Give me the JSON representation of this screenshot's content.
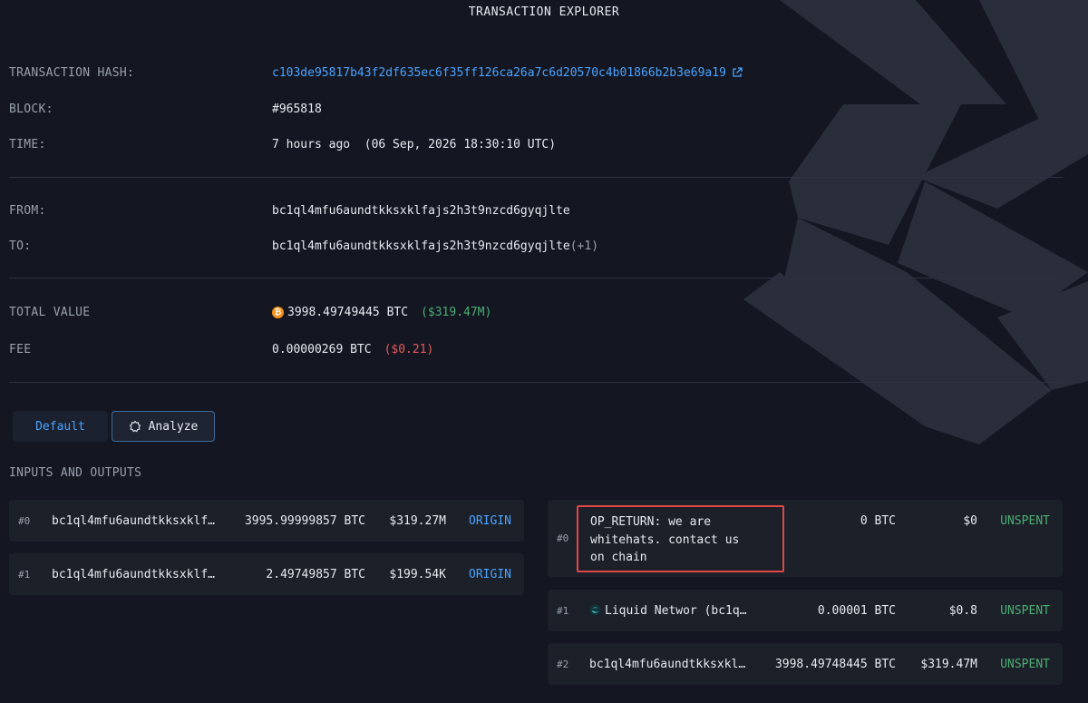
{
  "page_title": "TRANSACTION EXPLORER",
  "details": {
    "hash_label": "TRANSACTION HASH:",
    "hash_value": "c103de95817b43f2df635ec6f35ff126ca26a7c6d20570c4b01866b2b3e69a19",
    "block_label": "BLOCK:",
    "block_value": "#965818",
    "time_label": "TIME:",
    "time_value": "7 hours ago  (06 Sep, 2026 18:30:10 UTC)",
    "from_label": "FROM:",
    "from_value": "bc1ql4mfu6aundtkksxklfajs2h3t9nzcd6gyqjlte",
    "to_label": "TO:",
    "to_value": "bc1ql4mfu6aundtkksxklfajs2h3t9nzcd6gyqjlte",
    "to_extra": "(+1)",
    "total_label": "TOTAL VALUE",
    "total_value": "3998.49749445 BTC",
    "total_usd": "($319.47M)",
    "fee_label": "FEE",
    "fee_value": "0.00000269 BTC",
    "fee_usd": "($0.21)"
  },
  "tabs": {
    "default_label": "Default",
    "analyze_label": "Analyze"
  },
  "io_title": "INPUTS AND OUTPUTS",
  "inputs": [
    {
      "index": "#0",
      "address": "bc1ql4mfu6aundtkksxklf…",
      "amount": "3995.99999857 BTC",
      "usd": "$319.27M",
      "tag": "ORIGIN"
    },
    {
      "index": "#1",
      "address": "bc1ql4mfu6aundtkksxklf…",
      "amount": "2.49749857 BTC",
      "usd": "$199.54K",
      "tag": "ORIGIN"
    }
  ],
  "outputs": [
    {
      "index": "#0",
      "address_lines": [
        "OP_RETURN: we are",
        "whitehats. contact us",
        "on chain"
      ],
      "amount": "0 BTC",
      "usd": "$0",
      "tag": "UNSPENT"
    },
    {
      "index": "#1",
      "address": "Liquid Networ (bc1q…",
      "amount": "0.00001 BTC",
      "usd": "$0.8",
      "tag": "UNSPENT"
    },
    {
      "index": "#2",
      "address": "bc1ql4mfu6aundtkksxkl…",
      "amount": "3998.49748445 BTC",
      "usd": "$319.47M",
      "tag": "UNSPENT"
    }
  ],
  "colors": {
    "background": "#141722",
    "link": "#4aa3ff",
    "positive": "#4caf73",
    "negative": "#e45a5a",
    "highlight_border": "#e04848",
    "btc": "#f7931a"
  },
  "icons": {
    "external_link": "external-link-icon",
    "btc": "bitcoin-icon",
    "analyze": "analyze-icon",
    "liquid": "liquid-network-icon"
  }
}
